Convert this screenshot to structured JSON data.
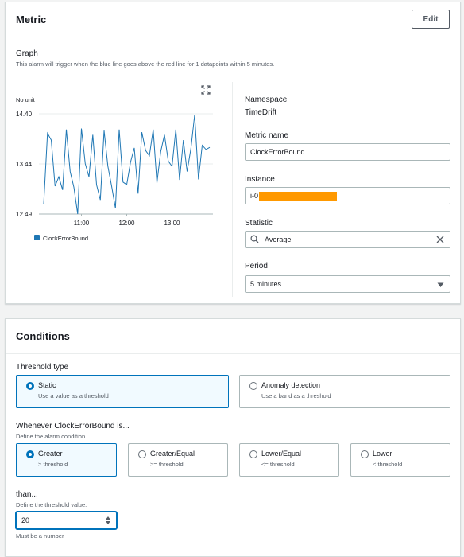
{
  "metric": {
    "title": "Metric",
    "edit_label": "Edit",
    "graph_label": "Graph",
    "graph_desc": "This alarm will trigger when the blue line goes above the red line for 1 datapoints within 5 minutes.",
    "fields": {
      "namespace_label": "Namespace",
      "namespace_value": "TimeDrift",
      "metric_name_label": "Metric name",
      "metric_name_value": "ClockErrorBound",
      "instance_label": "Instance",
      "instance_value": "i-0",
      "statistic_label": "Statistic",
      "statistic_value": "Average",
      "period_label": "Period",
      "period_value": "5 minutes"
    }
  },
  "chart_data": {
    "type": "line",
    "unit_label": "No unit",
    "ytick_labels": [
      "14.40",
      "13.44",
      "12.49"
    ],
    "ylim": [
      12.49,
      14.4
    ],
    "xtick_labels": [
      "11:00",
      "12:00",
      "13:00"
    ],
    "xtick_positions": [
      10,
      22,
      34
    ],
    "legend": "ClockErrorBound",
    "series": [
      {
        "name": "ClockErrorBound",
        "color": "#1f77b4",
        "values": [
          12.68,
          14.03,
          13.9,
          13.02,
          13.2,
          12.95,
          14.1,
          13.3,
          13.0,
          12.49,
          14.12,
          13.45,
          13.2,
          14.0,
          13.05,
          12.76,
          14.08,
          13.4,
          13.02,
          12.6,
          14.1,
          13.1,
          13.05,
          13.48,
          13.75,
          12.88,
          14.05,
          13.7,
          13.6,
          14.1,
          13.08,
          13.68,
          14.0,
          13.5,
          13.4,
          14.1,
          13.14,
          13.9,
          13.3,
          13.74,
          14.38,
          13.15,
          13.8,
          13.72,
          13.76
        ]
      }
    ]
  },
  "conditions": {
    "title": "Conditions",
    "threshold_type_label": "Threshold type",
    "threshold_options": [
      {
        "title": "Static",
        "desc": "Use a value as a threshold"
      },
      {
        "title": "Anomaly detection",
        "desc": "Use a band as a threshold"
      }
    ],
    "whenever_label": "Whenever ClockErrorBound is...",
    "whenever_desc": "Define the alarm condition.",
    "operators": [
      {
        "title": "Greater",
        "desc": "> threshold"
      },
      {
        "title": "Greater/Equal",
        "desc": ">= threshold"
      },
      {
        "title": "Lower/Equal",
        "desc": "<= threshold"
      },
      {
        "title": "Lower",
        "desc": "< threshold"
      }
    ],
    "than_label": "than...",
    "than_desc": "Define the threshold value.",
    "threshold_value": "20",
    "threshold_hint": "Must be a number"
  },
  "colors": {
    "accent": "#0073bb",
    "line": "#1f77b4",
    "redaction": "#ff9900"
  }
}
